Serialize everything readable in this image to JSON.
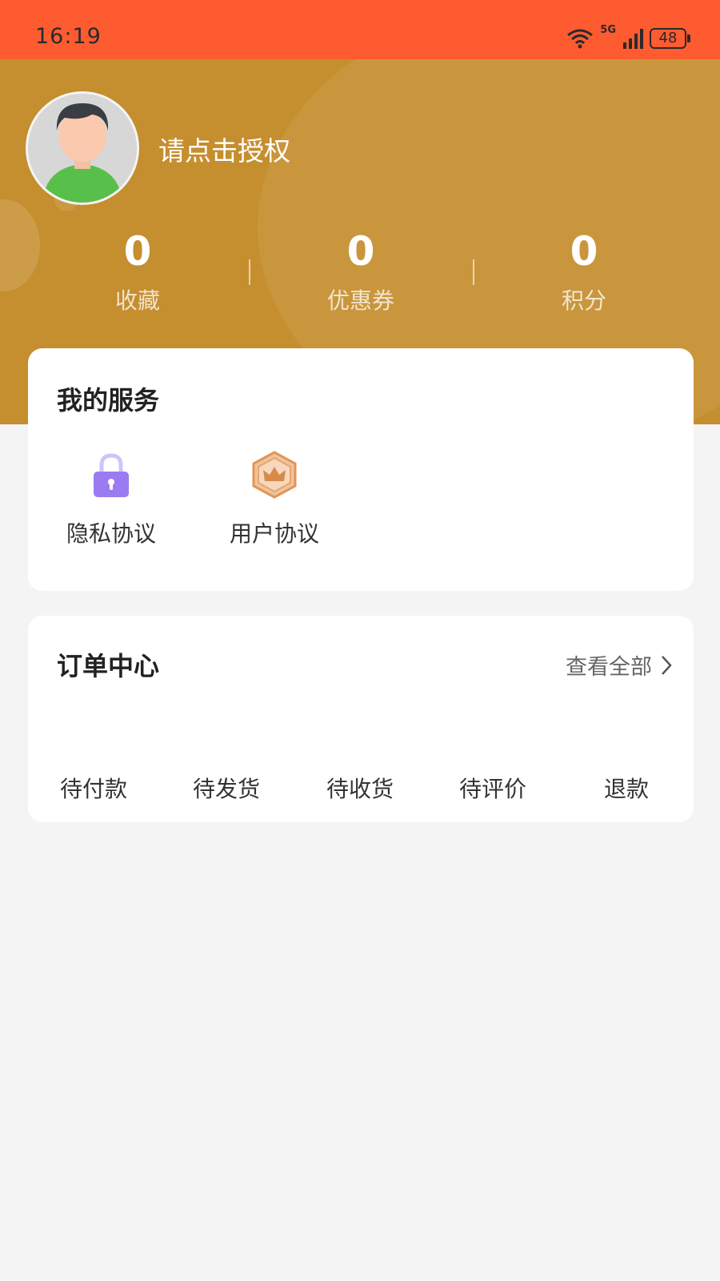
{
  "status_bar": {
    "time": "16:19",
    "network": "5G",
    "battery": "48"
  },
  "profile": {
    "username": "请点击授权"
  },
  "stats": [
    {
      "value": "0",
      "label": "收藏"
    },
    {
      "value": "0",
      "label": "优惠券"
    },
    {
      "value": "0",
      "label": "积分"
    }
  ],
  "services": {
    "title": "我的服务",
    "items": [
      {
        "label": "隐私协议",
        "icon": "lock-icon"
      },
      {
        "label": "用户协议",
        "icon": "crown-badge-icon"
      }
    ]
  },
  "orders": {
    "title": "订单中心",
    "view_all": "查看全部",
    "tabs": [
      "待付款",
      "待发货",
      "待收货",
      "待评价",
      "退款"
    ]
  },
  "colors": {
    "status_bar": "#fe5b30",
    "header": "#c58e2f",
    "lock_icon": "#9b7cf0",
    "badge_icon": "#e0955a"
  }
}
